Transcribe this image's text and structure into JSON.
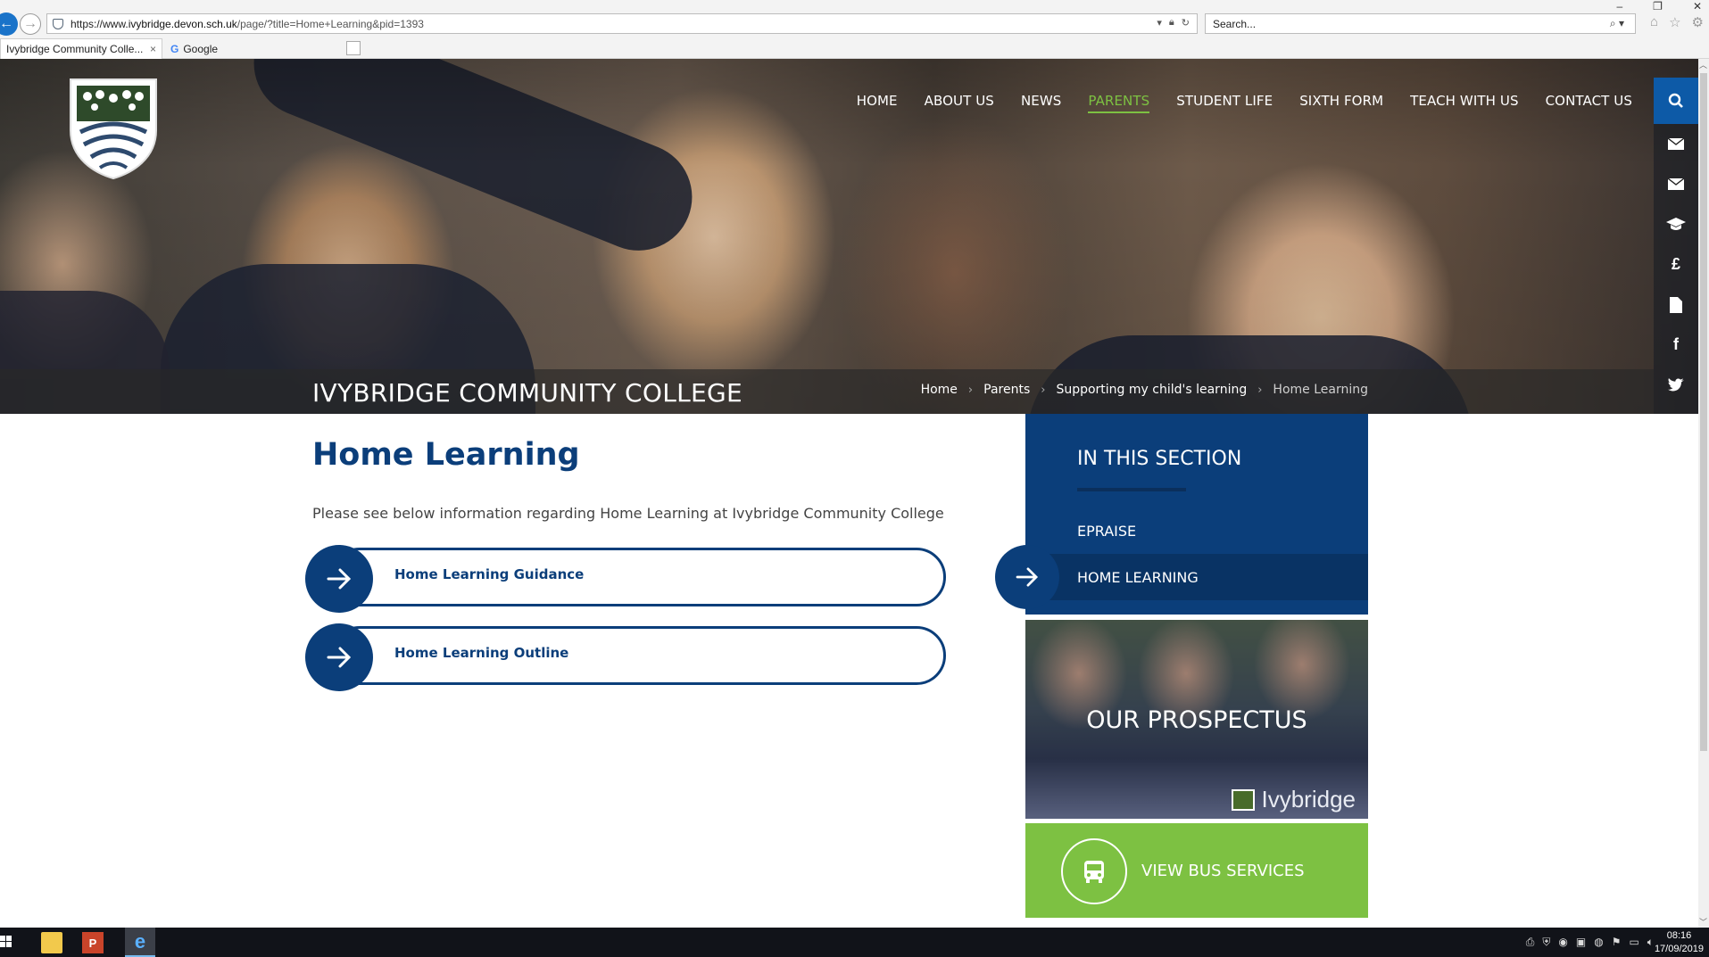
{
  "browser": {
    "url_prefix": "https://www.",
    "url_host": "ivybridge.devon.sch.uk",
    "url_rest": "/page/?title=Home+Learning&pid=1393",
    "search_placeholder": "Search...",
    "tabs": [
      {
        "label": "Ivybridge Community Colle...",
        "close": "×"
      },
      {
        "label": "Google",
        "favicon": "G"
      }
    ]
  },
  "nav": {
    "items": [
      "HOME",
      "ABOUT US",
      "NEWS",
      "PARENTS",
      "STUDENT LIFE",
      "SIXTH FORM",
      "TEACH WITH US",
      "CONTACT US"
    ],
    "active": "PARENTS",
    "accent": "#7dc142"
  },
  "rail": {
    "icons": [
      "search-icon",
      "envelope-icon",
      "envelope-icon",
      "graduation-cap-icon",
      "pound-icon",
      "document-icon",
      "facebook-icon",
      "twitter-icon"
    ],
    "pound": "£",
    "facebook": "f"
  },
  "header": {
    "site_name": "IVYBRIDGE COMMUNITY COLLEGE",
    "breadcrumb": [
      "Home",
      "Parents",
      "Supporting my child's learning",
      "Home Learning"
    ]
  },
  "content": {
    "title": "Home Learning",
    "intro": "Please see below information regarding Home Learning at Ivybridge Community College",
    "links": [
      {
        "label": "Home Learning Guidance"
      },
      {
        "label": "Home Learning Outline"
      }
    ]
  },
  "sidebar": {
    "section_title": "IN THIS SECTION",
    "items": [
      {
        "label": "EPRAISE"
      },
      {
        "label": "HOME LEARNING",
        "active": true
      }
    ],
    "prospectus_title": "OUR PROSPECTUS",
    "prospectus_brand": "Ivybridge",
    "bus_label": "VIEW BUS SERVICES"
  },
  "colors": {
    "brand_blue": "#0b3e7a",
    "brand_green": "#7dc142"
  },
  "taskbar": {
    "time": "08:16",
    "date": "17/09/2019"
  }
}
